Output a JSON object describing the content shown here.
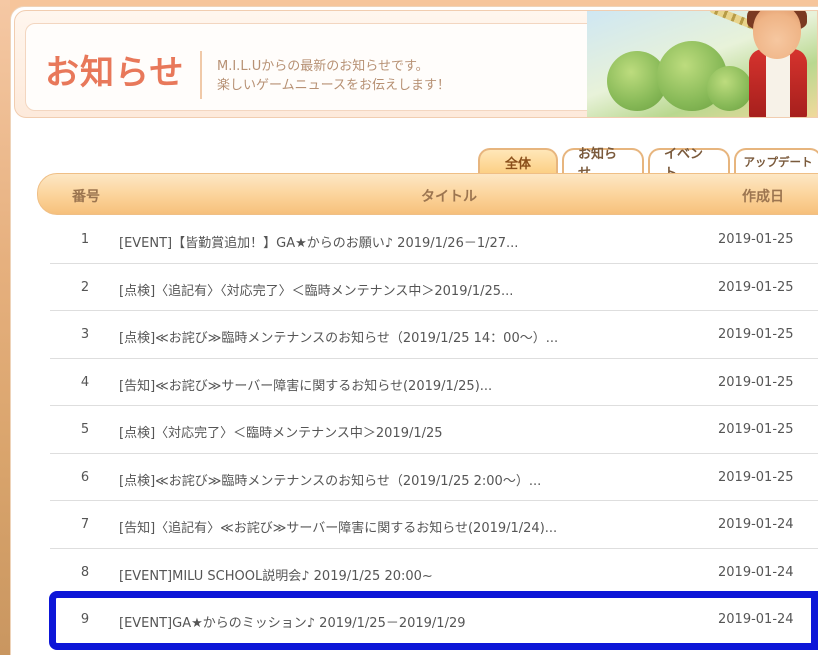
{
  "header": {
    "title": "お知らせ",
    "description_line1": "M.I.L.Uからの最新のお知らせです。",
    "description_line2": "楽しいゲームニュースをお伝えします！"
  },
  "tabs": [
    {
      "label": "全体",
      "active": true
    },
    {
      "label": "お知らせ",
      "active": false
    },
    {
      "label": "イベント",
      "active": false
    },
    {
      "label": "アップデート",
      "active": false
    }
  ],
  "table": {
    "columns": {
      "no": "番号",
      "title": "タイトル",
      "date": "作成日"
    },
    "rows": [
      {
        "no": "1",
        "title": "[EVENT]【皆勤賞追加！】GA★からのお願い♪ 2019/1/26－1/27...",
        "date": "2019-01-25"
      },
      {
        "no": "2",
        "title": "[点検]〈追記有〉〈対応完了〉＜臨時メンテナンス中＞2019/1/25...",
        "date": "2019-01-25"
      },
      {
        "no": "3",
        "title": "[点検]≪お詫び≫臨時メンテナンスのお知らせ（2019/1/25 14：00～）...",
        "date": "2019-01-25"
      },
      {
        "no": "4",
        "title": "[告知]≪お詫び≫サーバー障害に関するお知らせ(2019/1/25)...",
        "date": "2019-01-25"
      },
      {
        "no": "5",
        "title": "[点検]〈対応完了〉＜臨時メンテナンス中＞2019/1/25",
        "date": "2019-01-25"
      },
      {
        "no": "6",
        "title": "[点検]≪お詫び≫臨時メンテナンスのお知らせ（2019/1/25 2:00～）...",
        "date": "2019-01-25"
      },
      {
        "no": "7",
        "title": "[告知]〈追記有〉≪お詫び≫サーバー障害に関するお知らせ(2019/1/24)...",
        "date": "2019-01-24"
      },
      {
        "no": "8",
        "title": "[EVENT]MILU SCHOOL説明会♪ 2019/1/25 20:00~",
        "date": "2019-01-24"
      },
      {
        "no": "9",
        "title": "[EVENT]GA★からのミッション♪ 2019/1/25－2019/1/29",
        "date": "2019-01-24",
        "highlighted": true
      }
    ]
  },
  "colors": {
    "accent_title": "#e8785a",
    "tab_active": "#fccf83",
    "highlight_border": "#0d16d8"
  }
}
